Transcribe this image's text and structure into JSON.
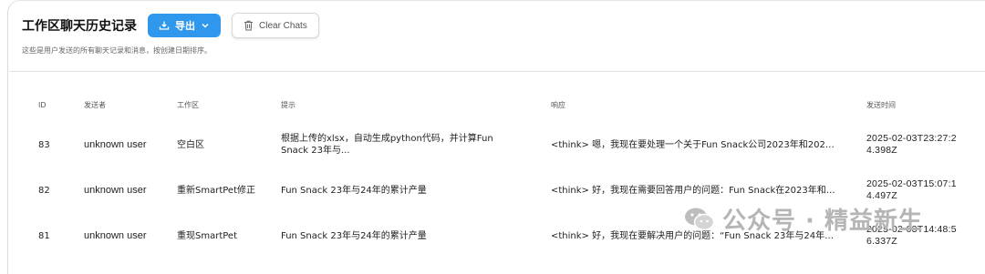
{
  "header": {
    "title": "工作区聊天历史记录",
    "export_label": "导出",
    "clear_label": "Clear Chats"
  },
  "subtitle": "这些是用户发送的所有聊天记录和消息，按创建日期排序。",
  "table": {
    "columns": [
      "ID",
      "发送者",
      "工作区",
      "提示",
      "响应",
      "发送时间"
    ],
    "rows": [
      {
        "id": "83",
        "sender": "unknown user",
        "workspace": "空白区",
        "prompt": "根据上传的xlsx，自动生成python代码，并计算Fun Snack 23年与...",
        "response": "<think> 嗯，我现在要处理一个关于Fun Snack公司2023年和2024年...",
        "time": "2025-02-03T23:27:24.398Z"
      },
      {
        "id": "82",
        "sender": "unknown user",
        "workspace": "重新SmartPet修正",
        "prompt": "Fun Snack 23年与24年的累计产量",
        "response": "<think> 好，我现在需要回答用户的问题：Fun Snack在2023年和2024年...",
        "time": "2025-02-03T15:07:14.497Z"
      },
      {
        "id": "81",
        "sender": "unknown user",
        "workspace": "重现SmartPet",
        "prompt": "Fun Snack 23年与24年的累计产量",
        "response": "<think> 好，我现在要解决用户的问题：“Fun Snack 23年与24年的...",
        "time": "2025-02-03T14:48:56.337Z"
      }
    ]
  },
  "watermark": "公众号 · 精益新生",
  "colors": {
    "accent": "#2f98ec",
    "divider": "#e3e3e3"
  },
  "icons": {
    "export": "download-tray-icon",
    "export_caret": "chevron-down-icon",
    "clear": "trash-icon",
    "watermark": "wechat-icon"
  }
}
